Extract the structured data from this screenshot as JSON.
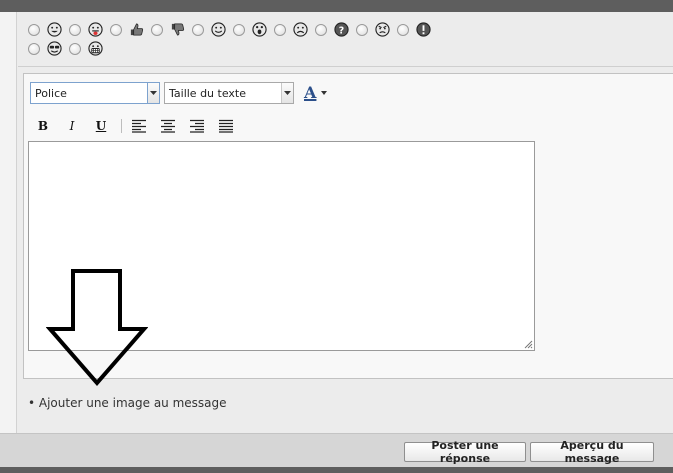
{
  "smileys": {
    "row1": [
      "grin-smiley-icon",
      "tongue-smiley-icon",
      "thumbs-up-icon",
      "thumbs-down-icon",
      "smile-smiley-icon",
      "surprised-smiley-icon",
      "sad-smiley-icon",
      "question-smiley-icon",
      "angry-smiley-icon",
      "exclamation-smiley-icon"
    ],
    "row2": [
      "cool-smiley-icon",
      "teeth-smiley-icon"
    ]
  },
  "toolbar": {
    "font_select": "Police",
    "size_select": "Taille du texte",
    "color_glyph": "A"
  },
  "format": {
    "bold": "B",
    "italic": "I",
    "underline": "U"
  },
  "hint": {
    "add_image": "• Ajouter une image au message"
  },
  "actions": {
    "post_reply": "Poster une réponse",
    "preview": "Aperçu du message"
  },
  "colors": {
    "top_bar": "#5e5e5e",
    "select_focus_border": "#7da2ce",
    "color_a": "#2b4f8a"
  }
}
